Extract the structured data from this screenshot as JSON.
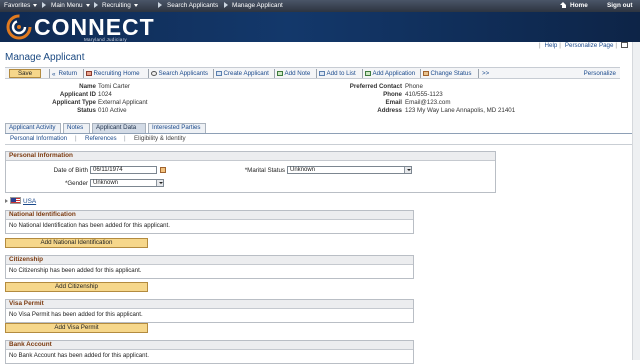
{
  "topnav": {
    "favorites": "Favorites",
    "main_menu": "Main Menu",
    "crumbs": [
      "Recruiting",
      "Search Applicants",
      "Manage Applicant"
    ],
    "home": "Home",
    "signout": "Sign out"
  },
  "banner": {
    "logo_text": "CONNECT",
    "logo_sub": "Maryland Judiciary"
  },
  "util": {
    "help": "Help",
    "personalize_page": "Personalize Page"
  },
  "page_title": "Manage Applicant",
  "toolbar": {
    "save": "Save",
    "items": [
      "Return",
      "Recruiting Home",
      "Search Applicants",
      "Create Applicant",
      "Add Note",
      "Add to List",
      "Add Application",
      "Change Status",
      ">>"
    ],
    "personalize": "Personalize"
  },
  "applicant": {
    "labels": [
      "Name",
      "Applicant ID",
      "Applicant Type",
      "Status"
    ],
    "values": [
      "Tomi Carter",
      "1024",
      "External Applicant",
      "010 Active"
    ],
    "right_labels": [
      "Preferred Contact",
      "Phone",
      "Email",
      "Address"
    ],
    "right_values": [
      "Phone",
      "410/555-1123",
      "Email@123.com",
      "123 My Way Lane Annapolis, MD 21401"
    ]
  },
  "tabs": [
    "Applicant Activity",
    "Notes",
    "Applicant Data",
    "Interested Parties"
  ],
  "subtabs": [
    "Personal Information",
    "References",
    "Eligibility & Identity"
  ],
  "personal": {
    "header": "Personal Information",
    "dob_label": "Date of Birth",
    "dob_value": "06/11/1974",
    "gender_label": "*Gender",
    "gender_value": "Unknown",
    "marital_label": "*Marital Status",
    "marital_value": "Unknown"
  },
  "country": "USA",
  "sections": [
    {
      "title": "National Identification",
      "message": "No National Identification has been added for this applicant.",
      "button": "Add National Identification"
    },
    {
      "title": "Citizenship",
      "message": "No Citizenship has been added for this applicant.",
      "button": "Add Citizenship"
    },
    {
      "title": "Visa Permit",
      "message": "No Visa Permit has been added for this applicant.",
      "button": "Add Visa Permit"
    },
    {
      "title": "Bank Account",
      "message": "No Bank Account has been added for this applicant."
    }
  ],
  "colors": {
    "nav_bg": "#2d3440",
    "banner_bg": "#13386b",
    "link": "#1b4a8c",
    "section_title": "#7c3b10",
    "button": "#f6d78b"
  }
}
